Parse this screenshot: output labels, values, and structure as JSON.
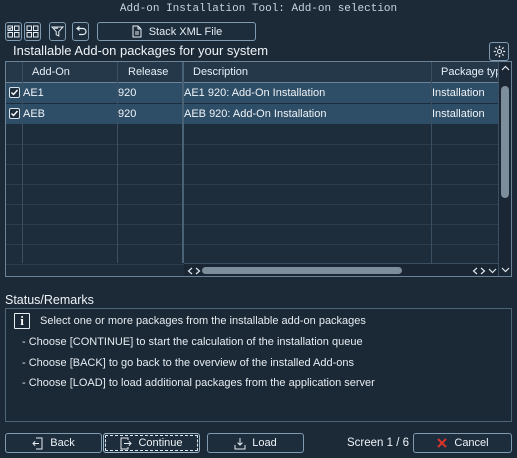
{
  "window": {
    "title": "Add-on Installation Tool: Add-on selection"
  },
  "toolbar": {
    "stack_xml_label": "Stack XML File"
  },
  "section": {
    "title": "Installable Add-on packages for your system"
  },
  "table": {
    "columns": [
      "Add-On",
      "Release",
      "Description",
      "Package type"
    ],
    "rows": [
      {
        "checked": true,
        "addon": "AE1",
        "release": "920",
        "description": "AE1 920: Add-On Installation",
        "type": "Installation"
      },
      {
        "checked": true,
        "addon": "AEB",
        "release": "920",
        "description": "AEB 920: Add-On Installation",
        "type": "Installation"
      }
    ]
  },
  "status": {
    "label": "Status/Remarks",
    "messages": [
      "Select one or more packages from the installable add-on packages",
      "- Choose [CONTINUE] to start the calculation of the installation queue",
      "- Choose [BACK] to go back to the overview of the installed Add-ons",
      "- Choose [LOAD] to load additional packages from the application server"
    ]
  },
  "footer": {
    "back_label": "Back",
    "continue_label": "Continue",
    "load_label": "Load",
    "screen_label": "Screen 1 / 6",
    "cancel_label": "Cancel"
  },
  "colors": {
    "background": "#1c2a38",
    "selected_row": "#2e4d66",
    "cancel_icon": "#d9342b"
  }
}
